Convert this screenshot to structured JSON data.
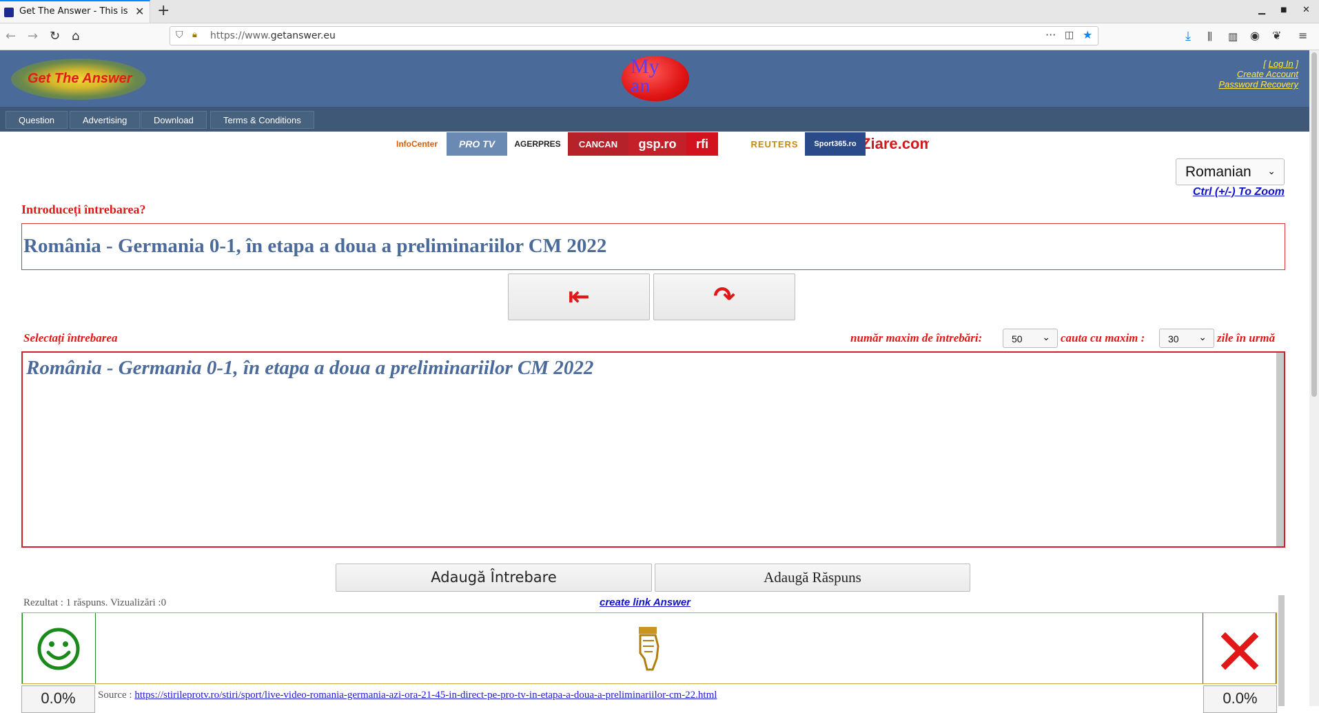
{
  "browser": {
    "tab_title": "Get The Answer - This is t",
    "new_tab": "+",
    "url_prefix": "https://www.",
    "url_domain": "getanswer.eu"
  },
  "site": {
    "logo_text": "Get The Answer",
    "globe_text": "My\nan",
    "account": {
      "login": "Log In",
      "create": "Create Account",
      "recovery": "Password Recovery"
    },
    "menu": [
      "Question",
      "Advertising",
      "Download",
      "Terms & Conditions"
    ],
    "news_logos": [
      "InfoCenter",
      "PRO TV",
      "AGERPRES",
      "CANCAN",
      "gsp.ro",
      "rfi",
      "REUTERS",
      "Sport365.ro",
      "Ziare.com"
    ]
  },
  "form": {
    "language": "Romanian",
    "zoom_hint": "Ctrl (+/-) To Zoom",
    "enter_question_label": "Introduceți întrebarea?",
    "question_value": "România - Germania 0-1, în etapa a doua a preliminariilor CM 2022",
    "back_symbol": "⇤",
    "redo_symbol": "↷",
    "select_question_label": "Selectați întrebarea",
    "max_questions_label": "număr maxim de întrebări:",
    "max_questions_value": "50",
    "search_max_label": "cauta cu maxim :",
    "search_days_value": "30",
    "days_back_label": "zile în urmă",
    "list_items": [
      "România - Germania 0-1, în etapa a doua a preliminariilor CM 2022"
    ],
    "add_question": "Adaugă Întrebare",
    "add_answer": "Adaugă Răspuns"
  },
  "result": {
    "summary": "Rezultat : 1 răspuns. Vizualizări :0",
    "create_link": "create link Answer",
    "pct_left": "0.0%",
    "pct_right": "0.0%",
    "source_label": "Source :",
    "source_url": "https://stirileprotv.ro/stiri/sport/live-video-romania-germania-azi-ora-21-45-in-direct-pe-pro-tv-in-etapa-a-doua-a-preliminariilor-cm-22.html"
  },
  "colors": {
    "header": "#4a6a9a",
    "menubar": "#3f5878",
    "accent_red": "#e01818",
    "link_yellow": "#ffe84a"
  }
}
